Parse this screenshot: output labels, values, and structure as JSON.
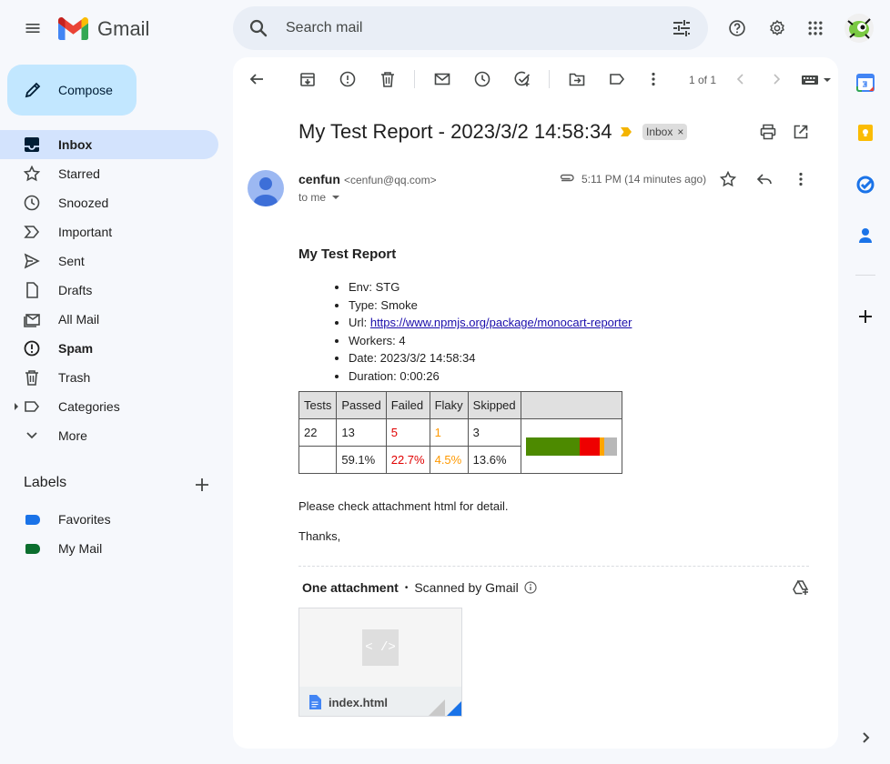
{
  "app": {
    "name": "Gmail"
  },
  "search": {
    "placeholder": "Search mail"
  },
  "compose": {
    "label": "Compose"
  },
  "nav": [
    {
      "label": "Inbox",
      "icon": "inbox-icon"
    },
    {
      "label": "Starred",
      "icon": "star-icon"
    },
    {
      "label": "Snoozed",
      "icon": "clock-icon"
    },
    {
      "label": "Important",
      "icon": "important-icon"
    },
    {
      "label": "Sent",
      "icon": "send-icon"
    },
    {
      "label": "Drafts",
      "icon": "draft-icon"
    },
    {
      "label": "All Mail",
      "icon": "all-mail-icon"
    },
    {
      "label": "Spam",
      "icon": "spam-icon"
    },
    {
      "label": "Trash",
      "icon": "trash-icon"
    },
    {
      "label": "Categories",
      "icon": "label-icon"
    },
    {
      "label": "More",
      "icon": "chevron-down-icon"
    }
  ],
  "labels": {
    "title": "Labels",
    "items": [
      {
        "label": "Favorites",
        "color": "#1a73e8"
      },
      {
        "label": "My Mail",
        "color": "#0b6e2e"
      }
    ]
  },
  "toolbar": {
    "pagination": "1 of 1"
  },
  "message": {
    "subject": "My Test Report - 2023/3/2 14:58:34",
    "inbox_chip": "Inbox",
    "chip_close": "×",
    "sender_name": "cenfun",
    "sender_email": "<cenfun@qq.com>",
    "to": "to me",
    "time": "5:11 PM (14 minutes ago)"
  },
  "report": {
    "title": "My Test Report",
    "details": {
      "env": "Env: STG",
      "type": "Type: Smoke",
      "url_prefix": "Url: ",
      "url": "https://www.npmjs.org/package/monocart-reporter",
      "workers": "Workers: 4",
      "date": "Date: 2023/3/2 14:58:34",
      "duration": "Duration: 0:00:26"
    },
    "table": {
      "headers": [
        "Tests",
        "Passed",
        "Failed",
        "Flaky",
        "Skipped"
      ],
      "counts": [
        "22",
        "13",
        "5",
        "1",
        "3"
      ],
      "percents": [
        "",
        "59.1%",
        "22.7%",
        "4.5%",
        "13.6%"
      ]
    },
    "bar": [
      {
        "name": "passed",
        "fraction": 0.591,
        "color": "#4d8a00"
      },
      {
        "name": "failed",
        "fraction": 0.227,
        "color": "#ee0000"
      },
      {
        "name": "flaky",
        "fraction": 0.045,
        "color": "#ffa500"
      },
      {
        "name": "skipped",
        "fraction": 0.136,
        "color": "#b8b8b8"
      }
    ],
    "check_msg": "Please check attachment html for detail.",
    "thanks": "Thanks,"
  },
  "attachments": {
    "title": "One attachment",
    "separator": "•",
    "scanned": "Scanned by Gmail",
    "file_name": "index.html",
    "preview_glyph": "< />"
  },
  "colors": {
    "accent": "#0b57d0",
    "compose_bg": "#c2e7ff",
    "active_nav": "#d3e3fd"
  }
}
